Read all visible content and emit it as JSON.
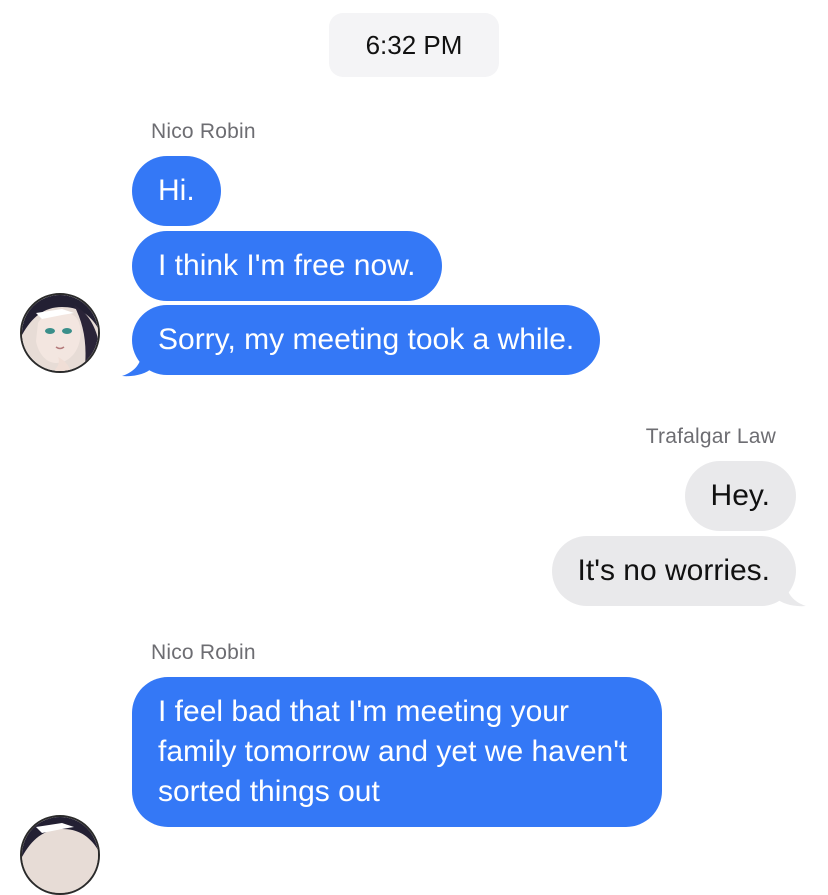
{
  "timestamp": "6:32 PM",
  "thread": [
    {
      "sender": "Nico Robin",
      "direction": "incoming",
      "messages": [
        "Hi.",
        "I think I'm free now.",
        "Sorry, my meeting took a while."
      ]
    },
    {
      "sender": "Trafalgar Law",
      "direction": "outgoing",
      "messages": [
        "Hey.",
        "It's no worries."
      ]
    },
    {
      "sender": "Nico Robin",
      "direction": "incoming",
      "messages": [
        "I feel bad that I'm meeting your family tomorrow and yet we haven't sorted things out"
      ]
    }
  ],
  "colors": {
    "incoming_bubble": "#3478f6",
    "outgoing_bubble": "#e9e9eb",
    "timestamp_pill": "#f4f4f6",
    "sender_label": "#6d6d72"
  },
  "icons": {
    "avatar": "nico-robin-avatar-icon"
  }
}
